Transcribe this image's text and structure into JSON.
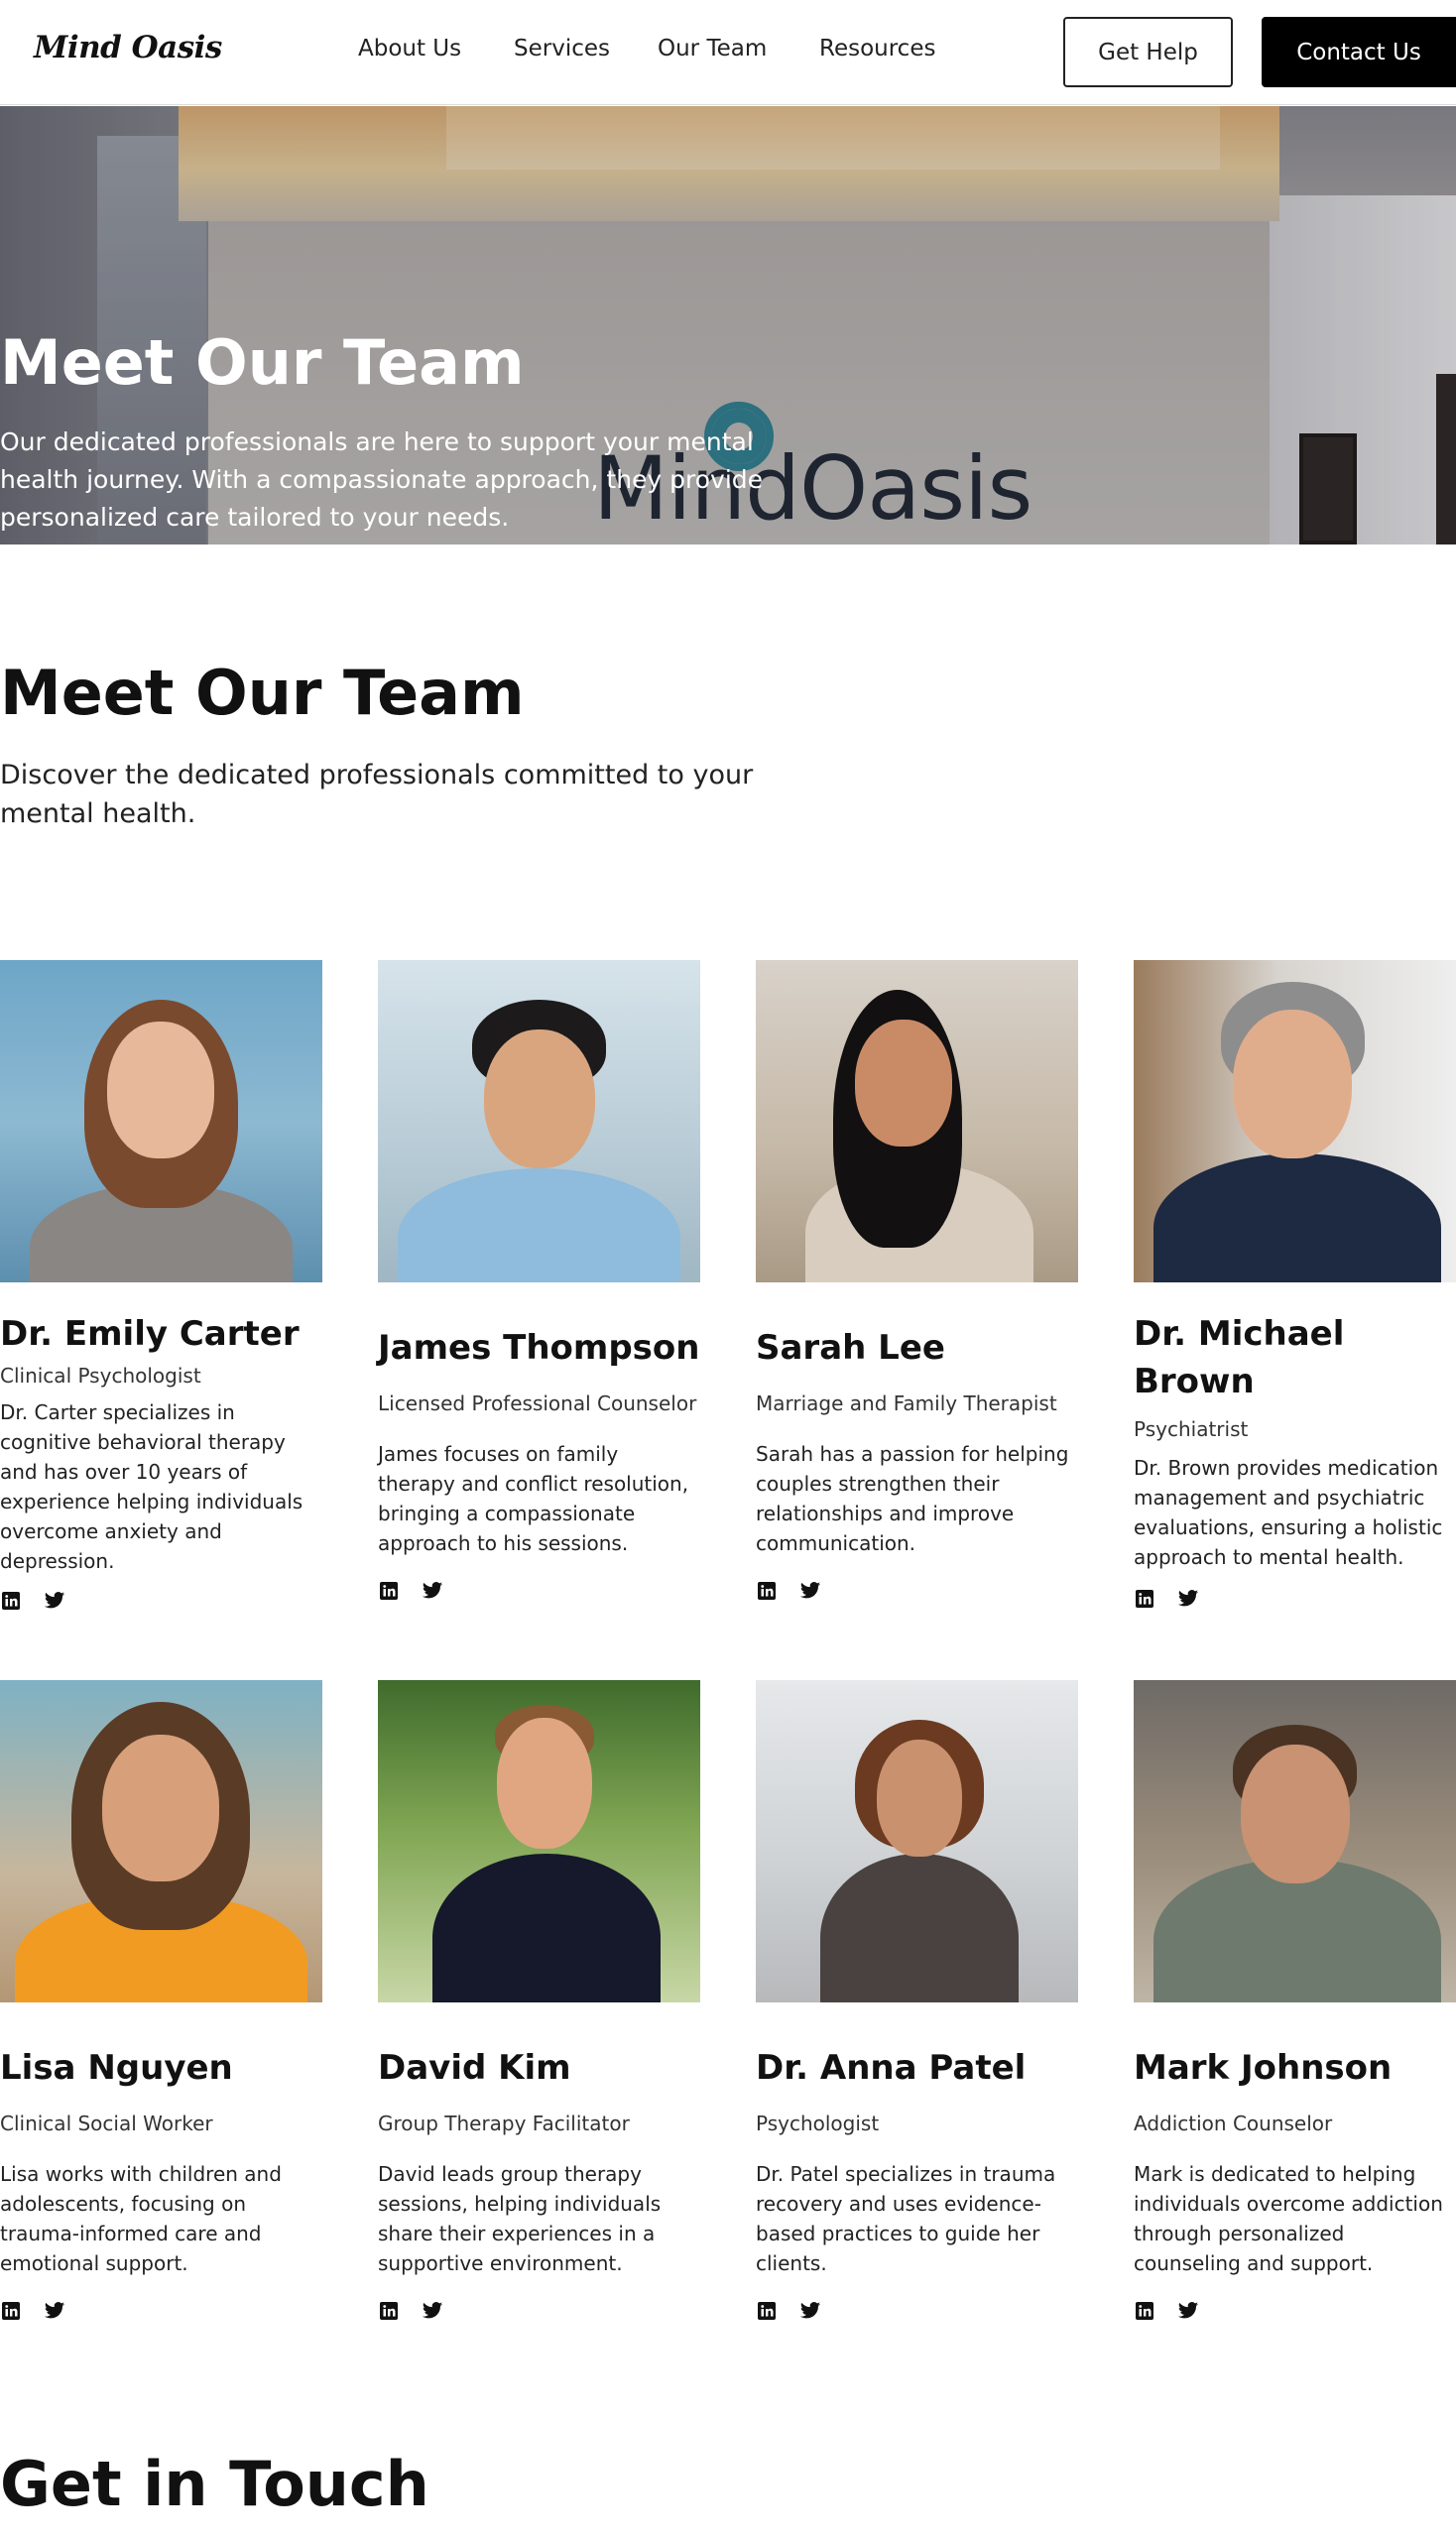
{
  "header": {
    "logo": "Mind Oasis",
    "nav": [
      "About Us",
      "Services",
      "Our Team",
      "Resources"
    ],
    "get_help": "Get Help",
    "contact_us": "Contact Us"
  },
  "hero": {
    "title": "Meet Our Team",
    "subtitle": "Our dedicated professionals are here to support your mental health journey. With a compassionate approach, they provide personalized care tailored to your needs.",
    "brand_sign": "MindOasis"
  },
  "team": {
    "title": "Meet Our Team",
    "subtitle": "Discover the dedicated professionals committed to your mental health.",
    "members": [
      {
        "name": "Dr. Emily Carter",
        "role": "Clinical Psychologist",
        "bio": "Dr. Carter specializes in cognitive behavioral therapy and has over 10 years of experience helping individuals overcome anxiety and depression."
      },
      {
        "name": "James Thompson",
        "role": "Licensed Professional Counselor",
        "bio": "James focuses on family therapy and conflict resolution, bringing a compassionate approach to his sessions."
      },
      {
        "name": "Sarah Lee",
        "role": "Marriage and Family Therapist",
        "bio": "Sarah has a passion for helping couples strengthen their relationships and improve communication."
      },
      {
        "name": "Dr. Michael Brown",
        "role": "Psychiatrist",
        "bio": "Dr. Brown provides medication management and psychiatric evaluations, ensuring a holistic approach to mental health."
      },
      {
        "name": "Lisa Nguyen",
        "role": "Clinical Social Worker",
        "bio": "Lisa works with children and adolescents, focusing on trauma-informed care and emotional support."
      },
      {
        "name": "David Kim",
        "role": "Group Therapy Facilitator",
        "bio": "David leads group therapy sessions, helping individuals share their experiences in a supportive environment."
      },
      {
        "name": "Dr. Anna Patel",
        "role": "Psychologist",
        "bio": "Dr. Patel specializes in trauma recovery and uses evidence-based practices to guide her clients."
      },
      {
        "name": "Mark Johnson",
        "role": "Addiction Counselor",
        "bio": "Mark is dedicated to helping individuals overcome addiction through personalized counseling and support."
      }
    ]
  },
  "contact": {
    "title": "Get in Touch"
  },
  "icons": {
    "linkedin": "linkedin-icon",
    "twitter": "twitter-icon"
  }
}
